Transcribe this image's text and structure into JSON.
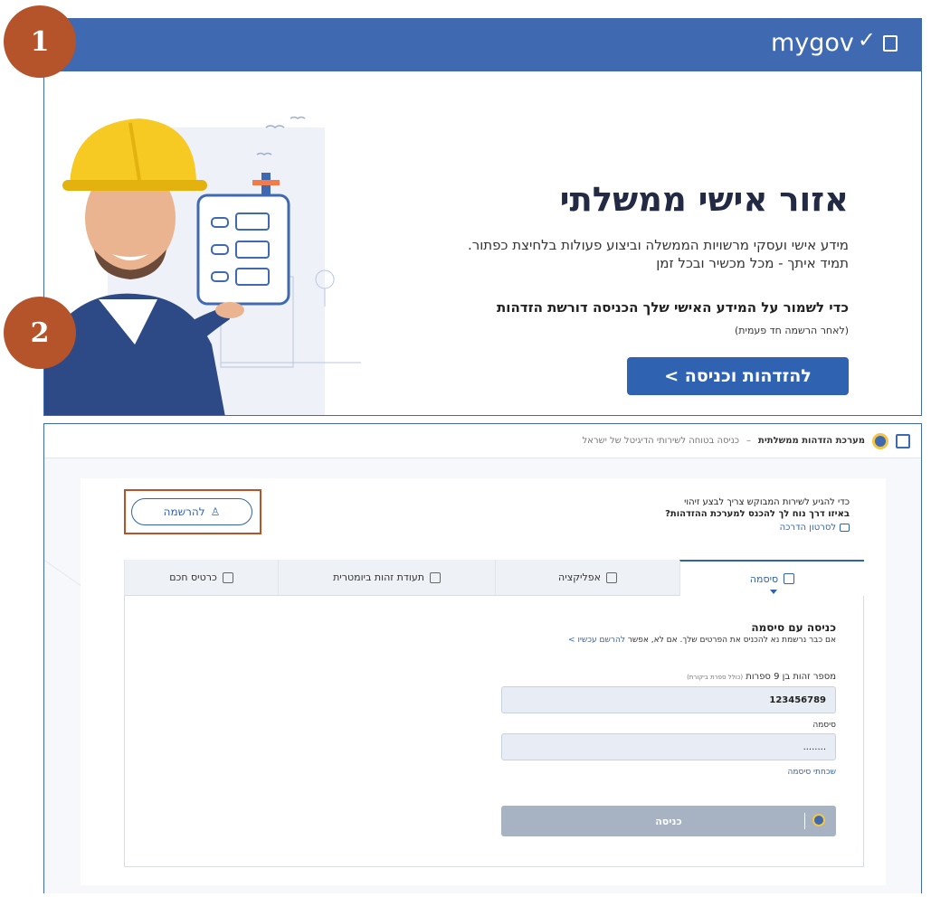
{
  "steps": {
    "one": "1",
    "two": "2"
  },
  "panel1": {
    "logo_text": "mygov",
    "title": "אזור אישי ממשלתי",
    "desc_line1": "מידע אישי ועסקי מרשויות הממשלה וביצוע פעולות בלחיצת כפתור.",
    "desc_line2": "תמיד איתך - מכל מכשיר ובכל זמן",
    "note": "כדי לשמור על המידע האישי שלך הכניסה דורשת הזדהות",
    "subnote": "(לאחר הרשמה חד פעמית)",
    "login_button": "להזדהות וכניסה >",
    "colors": {
      "brand": "#3f69b0",
      "button": "#2f63b2",
      "badge": "#b5532a"
    }
  },
  "panel2": {
    "header_title": "מערכת הזדהות ממשלתית",
    "header_sep": "–",
    "header_sub": "כניסה בטוחה לשירותי הדיגיטל של ישראל",
    "intro_line1": "כדי להגיע לשירות המבוקש צריך לבצע זיהוי",
    "intro_line2": "באיזו דרך נוח לך להכנס למערכת ההזדהות?",
    "intro_link": "לסרטון הדרכה",
    "register_button": "להרשמה",
    "tabs": [
      {
        "label": "סיסמה",
        "icon": "lock-icon"
      },
      {
        "label": "אפליקציה",
        "icon": "phone-icon"
      },
      {
        "label": "תעודת זהות ביומטרית",
        "icon": "id-card-icon"
      },
      {
        "label": "כרטיס חכם",
        "icon": "smart-card-icon"
      }
    ],
    "login_title": "כניסה עם סיסמה",
    "login_desc": "אם כבר נרשמת נא להכניס את הפרטים שלך. אם לא, אפשר",
    "login_desc_link": "להרשם עכשיו >",
    "id_label": "מספר זהות בן 9 ספרות",
    "id_hint": "(כולל ספרת ביקורת)",
    "id_value": "123456789",
    "password_label": "סיסמה",
    "password_value": "........",
    "forgot_password": "שכחתי סיסמה",
    "submit_button": "כניסה"
  }
}
